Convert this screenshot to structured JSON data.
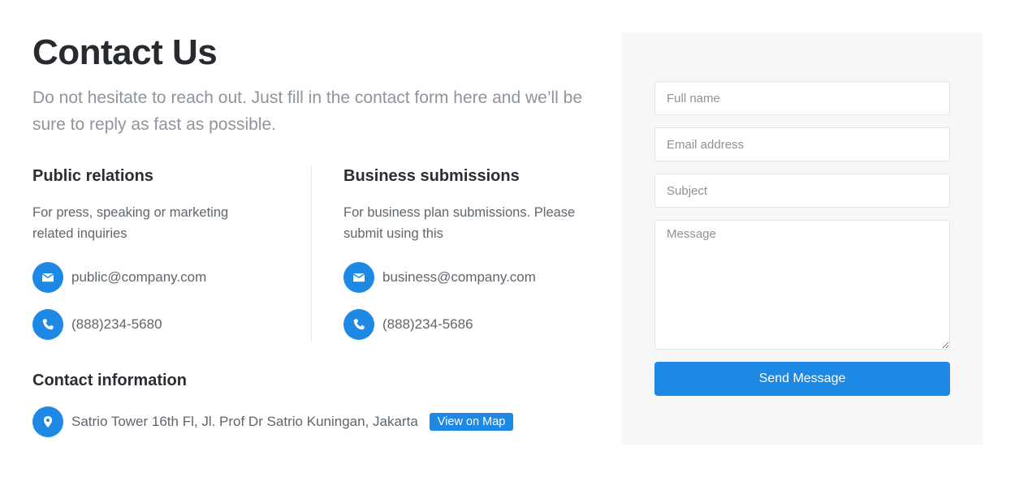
{
  "header": {
    "title": "Contact Us",
    "intro": "Do not hesitate to reach out. Just fill in the contact form here and we’ll be sure to reply as fast as possible."
  },
  "public_relations": {
    "title": "Public relations",
    "description": "For press, speaking or marketing related inquiries",
    "email": "public@company.com",
    "phone": "(888)234-5680",
    "email_icon": "envelope-icon",
    "phone_icon": "phone-icon"
  },
  "business_submissions": {
    "title": "Business submissions",
    "description": "For business plan submissions. Please submit using this",
    "email": "business@company.com",
    "phone": "(888)234-5686",
    "email_icon": "envelope-icon",
    "phone_icon": "phone-icon"
  },
  "contact_information": {
    "title": "Contact information",
    "address": "Satrio Tower 16th Fl, Jl. Prof Dr Satrio Kuningan, Jakarta",
    "map_button": "View on Map",
    "address_icon": "map-pin-icon"
  },
  "form": {
    "full_name_placeholder": "Full name",
    "email_placeholder": "Email address",
    "subject_placeholder": "Subject",
    "message_placeholder": "Message",
    "submit_label": "Send Message"
  },
  "colors": {
    "accent": "#1e88e5",
    "panel_background": "#f7f7f7",
    "muted_text": "#8f959b"
  }
}
